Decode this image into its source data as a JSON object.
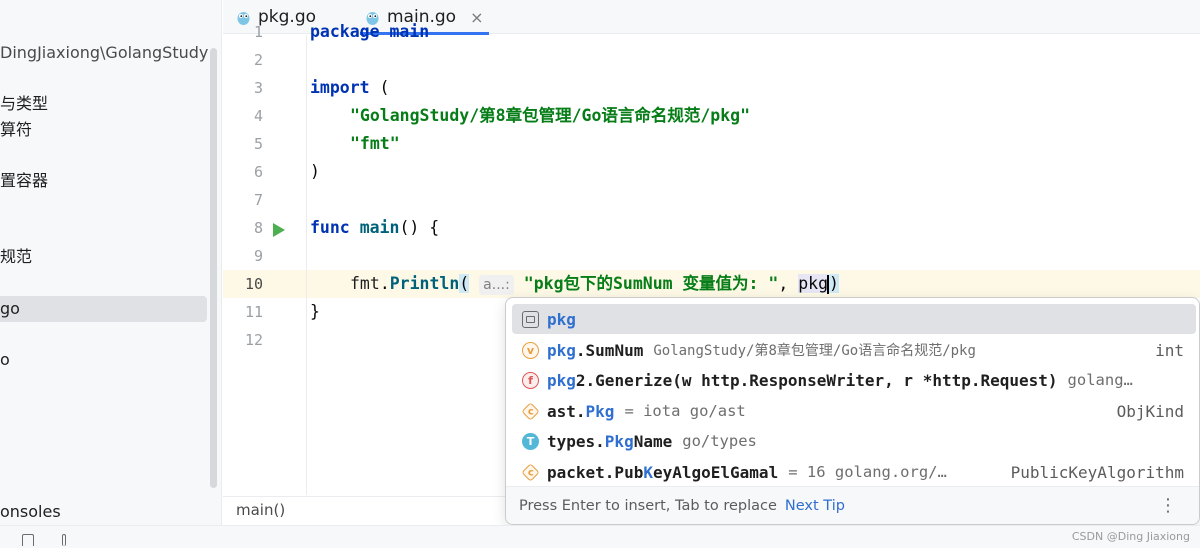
{
  "sidebar": {
    "path_label": "DingJiaxiong\\GolangStudy",
    "items": [
      {
        "label": "与类型"
      },
      {
        "label": "算符"
      },
      {
        "label": "置容器"
      },
      {
        "label": "规范"
      },
      {
        "label": "go"
      },
      {
        "label": "o"
      },
      {
        "label": "onsoles"
      }
    ]
  },
  "tabs": [
    {
      "label": "pkg.go",
      "icon": "gopher-icon"
    },
    {
      "label": "main.go",
      "icon": "gopher-icon",
      "close": "×"
    }
  ],
  "editor": {
    "lines": [
      {
        "n": "1",
        "text": "package main"
      },
      {
        "n": "2"
      },
      {
        "n": "3",
        "kw": "import",
        "rest": " ("
      },
      {
        "n": "4",
        "str": "\"GolangStudy/第8章包管理/Go语言命名规范/pkg\""
      },
      {
        "n": "5",
        "str": "\"fmt\""
      },
      {
        "n": "6",
        "text": ")"
      },
      {
        "n": "7"
      },
      {
        "n": "8",
        "kw": "func",
        "fn": "main",
        "rest": "() {"
      },
      {
        "n": "9"
      },
      {
        "n": "10",
        "pkgname": "fmt",
        "dot": ".",
        "fn": "Println",
        "paren": "(",
        "hint": "a...:",
        "str": "\"pkg包下的SumNum 变量值为: \"",
        "comma": ", ",
        "typed": "pkg",
        "close": ")"
      },
      {
        "n": "11",
        "text": "}"
      },
      {
        "n": "12"
      }
    ],
    "breadcrumb": "main()"
  },
  "completion": {
    "items": [
      {
        "icon": "package-icon",
        "letter": "",
        "match": "pkg",
        "rest": "",
        "location": "",
        "type": ""
      },
      {
        "icon": "variable-icon",
        "letter": "v",
        "match": "pkg",
        "rest": ".SumNum",
        "location": "GolangStudy/第8章包管理/Go语言命名规范/pkg",
        "type": "int"
      },
      {
        "icon": "function-icon",
        "letter": "f",
        "match": "pkg",
        "rest": "2.Generize(w http.ResponseWriter, r *http.Request)",
        "location": "golang…",
        "type": ""
      },
      {
        "icon": "constant-icon",
        "letter": "c",
        "prefix": "ast.",
        "match": "Pkg",
        "rest": "",
        "location": "= iota go/ast",
        "type": "ObjKind"
      },
      {
        "icon": "type-icon",
        "letter": "T",
        "prefix": "types.",
        "match": "Pkg",
        "rest": "Name",
        "location": "go/types",
        "type": ""
      },
      {
        "icon": "constant-icon",
        "letter": "c",
        "prefix": "packet.Pub",
        "match": "K",
        "rest": "eyAlgoElGamal",
        "location": "= 16 golang.org/…",
        "type": "PublicKeyAlgorithm"
      }
    ],
    "footer": {
      "hint": "Press Enter to insert, Tab to replace",
      "tip": "Next Tip",
      "more": "⋮"
    }
  },
  "watermark": "CSDN @Ding Jiaxiong",
  "colors": {
    "accent": "#3574f0",
    "keyword": "#0033b3",
    "string": "#067d17",
    "function": "#00627a",
    "run": "#4caf50"
  }
}
